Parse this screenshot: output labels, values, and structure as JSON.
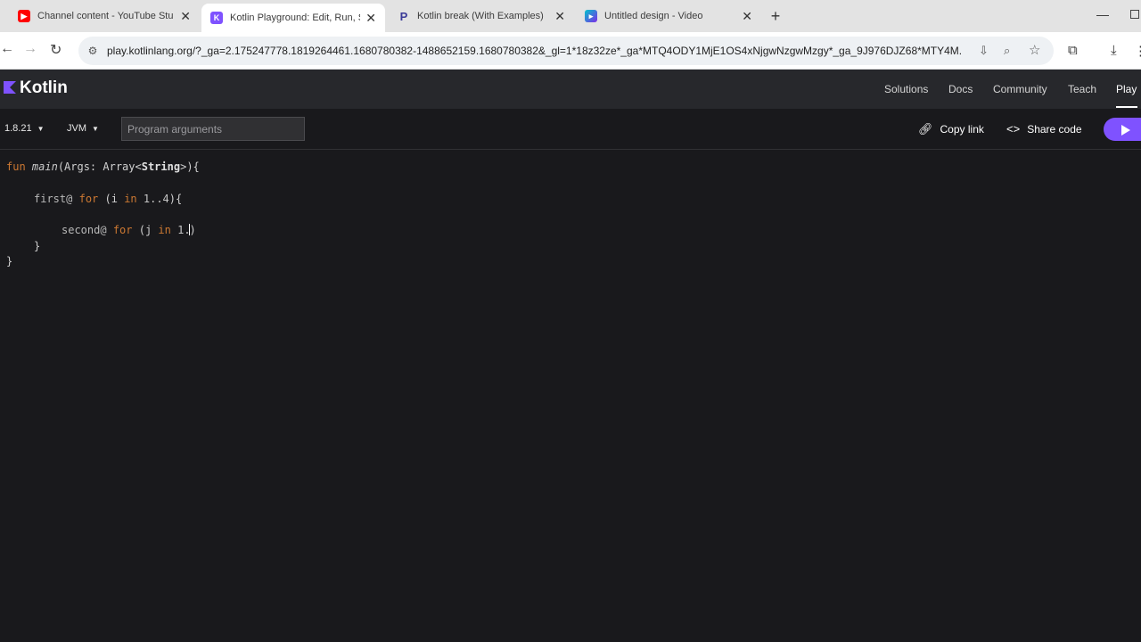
{
  "browser": {
    "tabs": [
      {
        "title": "Channel content - YouTube Stu",
        "favicon": "youtube-icon",
        "color": "#ff0000"
      },
      {
        "title": "Kotlin Playground: Edit, Run, Sh",
        "favicon": "kotlin-icon",
        "color": "#7f52ff"
      },
      {
        "title": "Kotlin break (With Examples)",
        "favicon": "programiz-icon",
        "color": "#3b3b98"
      },
      {
        "title": "Untitled design - Video",
        "favicon": "canva-icon",
        "color": "#00c4cc"
      }
    ],
    "url": "play.kotlinlang.org/?_ga=2.175247778.1819264461.1680780382-1488652159.1680780382&_gl=1*18z32ze*_ga*MTQ4ODY1MjE1OS4xNjgwNzgwMzgy*_ga_9J976DJZ68*MTY4M..."
  },
  "site": {
    "logo_text": "Kotlin",
    "nav": [
      "Solutions",
      "Docs",
      "Community",
      "Teach",
      "Play"
    ],
    "accent": "#7f52ff"
  },
  "playground": {
    "version": "1.8.21",
    "target": "JVM",
    "args_placeholder": "Program arguments",
    "copy_link": "Copy link",
    "share_code": "Share code"
  }
}
